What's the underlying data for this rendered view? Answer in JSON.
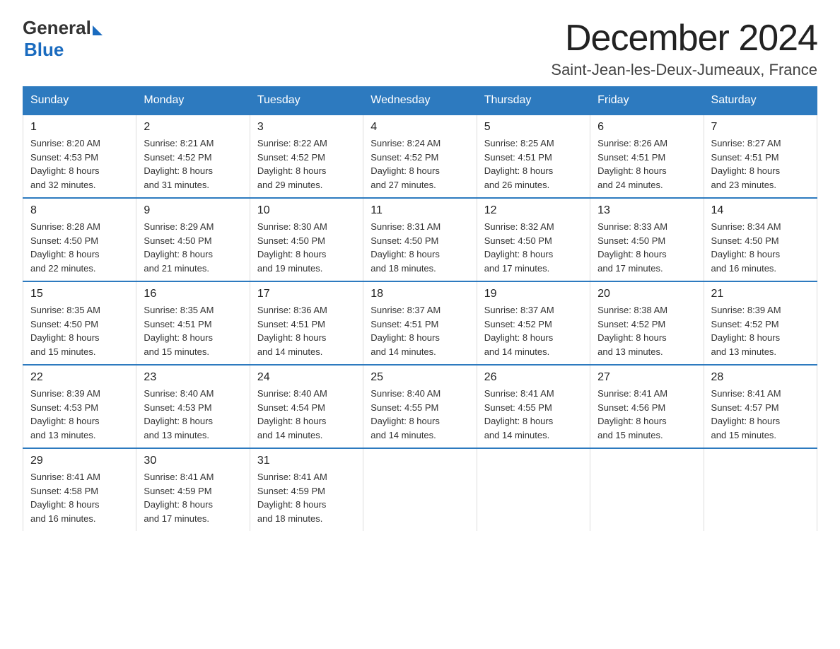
{
  "header": {
    "logo_general": "General",
    "logo_blue": "Blue",
    "month_title": "December 2024",
    "location": "Saint-Jean-les-Deux-Jumeaux, France"
  },
  "weekdays": [
    "Sunday",
    "Monday",
    "Tuesday",
    "Wednesday",
    "Thursday",
    "Friday",
    "Saturday"
  ],
  "weeks": [
    [
      {
        "day": "1",
        "sunrise": "8:20 AM",
        "sunset": "4:53 PM",
        "daylight": "8 hours and 32 minutes."
      },
      {
        "day": "2",
        "sunrise": "8:21 AM",
        "sunset": "4:52 PM",
        "daylight": "8 hours and 31 minutes."
      },
      {
        "day": "3",
        "sunrise": "8:22 AM",
        "sunset": "4:52 PM",
        "daylight": "8 hours and 29 minutes."
      },
      {
        "day": "4",
        "sunrise": "8:24 AM",
        "sunset": "4:52 PM",
        "daylight": "8 hours and 27 minutes."
      },
      {
        "day": "5",
        "sunrise": "8:25 AM",
        "sunset": "4:51 PM",
        "daylight": "8 hours and 26 minutes."
      },
      {
        "day": "6",
        "sunrise": "8:26 AM",
        "sunset": "4:51 PM",
        "daylight": "8 hours and 24 minutes."
      },
      {
        "day": "7",
        "sunrise": "8:27 AM",
        "sunset": "4:51 PM",
        "daylight": "8 hours and 23 minutes."
      }
    ],
    [
      {
        "day": "8",
        "sunrise": "8:28 AM",
        "sunset": "4:50 PM",
        "daylight": "8 hours and 22 minutes."
      },
      {
        "day": "9",
        "sunrise": "8:29 AM",
        "sunset": "4:50 PM",
        "daylight": "8 hours and 21 minutes."
      },
      {
        "day": "10",
        "sunrise": "8:30 AM",
        "sunset": "4:50 PM",
        "daylight": "8 hours and 19 minutes."
      },
      {
        "day": "11",
        "sunrise": "8:31 AM",
        "sunset": "4:50 PM",
        "daylight": "8 hours and 18 minutes."
      },
      {
        "day": "12",
        "sunrise": "8:32 AM",
        "sunset": "4:50 PM",
        "daylight": "8 hours and 17 minutes."
      },
      {
        "day": "13",
        "sunrise": "8:33 AM",
        "sunset": "4:50 PM",
        "daylight": "8 hours and 17 minutes."
      },
      {
        "day": "14",
        "sunrise": "8:34 AM",
        "sunset": "4:50 PM",
        "daylight": "8 hours and 16 minutes."
      }
    ],
    [
      {
        "day": "15",
        "sunrise": "8:35 AM",
        "sunset": "4:50 PM",
        "daylight": "8 hours and 15 minutes."
      },
      {
        "day": "16",
        "sunrise": "8:35 AM",
        "sunset": "4:51 PM",
        "daylight": "8 hours and 15 minutes."
      },
      {
        "day": "17",
        "sunrise": "8:36 AM",
        "sunset": "4:51 PM",
        "daylight": "8 hours and 14 minutes."
      },
      {
        "day": "18",
        "sunrise": "8:37 AM",
        "sunset": "4:51 PM",
        "daylight": "8 hours and 14 minutes."
      },
      {
        "day": "19",
        "sunrise": "8:37 AM",
        "sunset": "4:52 PM",
        "daylight": "8 hours and 14 minutes."
      },
      {
        "day": "20",
        "sunrise": "8:38 AM",
        "sunset": "4:52 PM",
        "daylight": "8 hours and 13 minutes."
      },
      {
        "day": "21",
        "sunrise": "8:39 AM",
        "sunset": "4:52 PM",
        "daylight": "8 hours and 13 minutes."
      }
    ],
    [
      {
        "day": "22",
        "sunrise": "8:39 AM",
        "sunset": "4:53 PM",
        "daylight": "8 hours and 13 minutes."
      },
      {
        "day": "23",
        "sunrise": "8:40 AM",
        "sunset": "4:53 PM",
        "daylight": "8 hours and 13 minutes."
      },
      {
        "day": "24",
        "sunrise": "8:40 AM",
        "sunset": "4:54 PM",
        "daylight": "8 hours and 14 minutes."
      },
      {
        "day": "25",
        "sunrise": "8:40 AM",
        "sunset": "4:55 PM",
        "daylight": "8 hours and 14 minutes."
      },
      {
        "day": "26",
        "sunrise": "8:41 AM",
        "sunset": "4:55 PM",
        "daylight": "8 hours and 14 minutes."
      },
      {
        "day": "27",
        "sunrise": "8:41 AM",
        "sunset": "4:56 PM",
        "daylight": "8 hours and 15 minutes."
      },
      {
        "day": "28",
        "sunrise": "8:41 AM",
        "sunset": "4:57 PM",
        "daylight": "8 hours and 15 minutes."
      }
    ],
    [
      {
        "day": "29",
        "sunrise": "8:41 AM",
        "sunset": "4:58 PM",
        "daylight": "8 hours and 16 minutes."
      },
      {
        "day": "30",
        "sunrise": "8:41 AM",
        "sunset": "4:59 PM",
        "daylight": "8 hours and 17 minutes."
      },
      {
        "day": "31",
        "sunrise": "8:41 AM",
        "sunset": "4:59 PM",
        "daylight": "8 hours and 18 minutes."
      },
      null,
      null,
      null,
      null
    ]
  ],
  "labels": {
    "sunrise": "Sunrise:",
    "sunset": "Sunset:",
    "daylight": "Daylight:"
  }
}
